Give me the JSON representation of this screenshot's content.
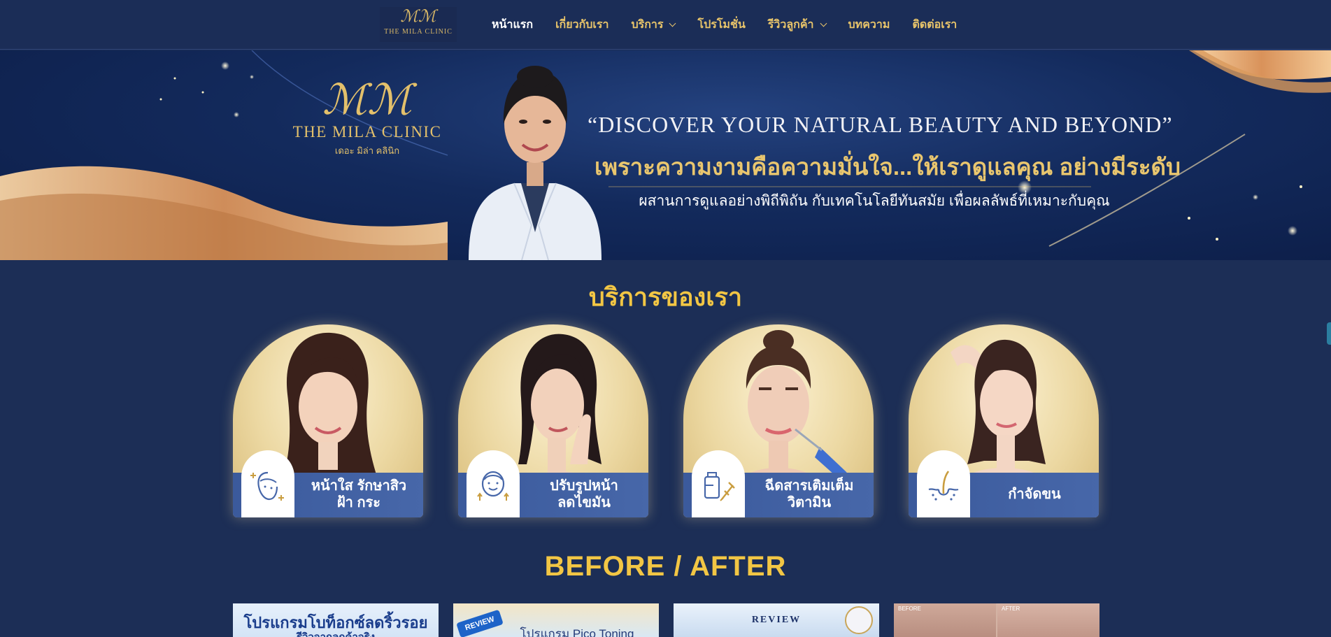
{
  "nav": {
    "logo_mark": "ℳℳ",
    "logo_name": "THE MILA CLINIC",
    "items": [
      {
        "label": "หน้าแรก",
        "active": true
      },
      {
        "label": "เกี่ยวกับเรา"
      },
      {
        "label": "บริการ",
        "dropdown": true
      },
      {
        "label": "โปรโมชั่น"
      },
      {
        "label": "รีวิวลูกค้า",
        "dropdown": true
      },
      {
        "label": "บทความ"
      },
      {
        "label": "ติดต่อเรา"
      }
    ]
  },
  "hero": {
    "logo_mark": "ℳℳ",
    "logo_name": "THE MILA CLINIC",
    "logo_sub": "เดอะ มิล่า คลินิก",
    "slogan": "“DISCOVER YOUR NATURAL BEAUTY AND BEYOND”",
    "tagline": "เพราะความงามคือความมั่นใจ...ให้เราดูแลคุณ อย่างมีระดับ",
    "subtag": "ผสานการดูแลอย่างพิถีพิถัน กับเทคโนโลยีทันสมัย เพื่อผลลัพธ์ที่เหมาะกับคุณ"
  },
  "services": {
    "title": "บริการของเรา",
    "cards": [
      {
        "label": "หน้าใส รักษาสิว\nฝ้า กระ",
        "icon": "face-care-icon"
      },
      {
        "label": "ปรับรูปหน้า\nลดไขมัน",
        "icon": "face-contour-icon"
      },
      {
        "label": "ฉีดสารเติมเต็ม\nวิตามิน",
        "icon": "injection-icon"
      },
      {
        "label": "กำจัดขน",
        "icon": "hair-removal-icon"
      }
    ]
  },
  "before_after": {
    "title": "BEFORE / AFTER",
    "reviews": [
      {
        "title": "โปรแกรมโบท็อกซ์ลดริ้วรอย",
        "subtitle": "รีวิวจากลูกค้าจริง"
      },
      {
        "badge": "REVIEW",
        "title": "โปรแกรม Pico Toning"
      },
      {
        "badge": "REVIEW"
      },
      {
        "labels": [
          "BEFORE",
          "AFTER"
        ]
      }
    ]
  },
  "colors": {
    "background": "#1c2e56",
    "accent_gold": "#f2c644",
    "menu_gold": "#e8c46a",
    "band_blue": "#4767a9"
  }
}
